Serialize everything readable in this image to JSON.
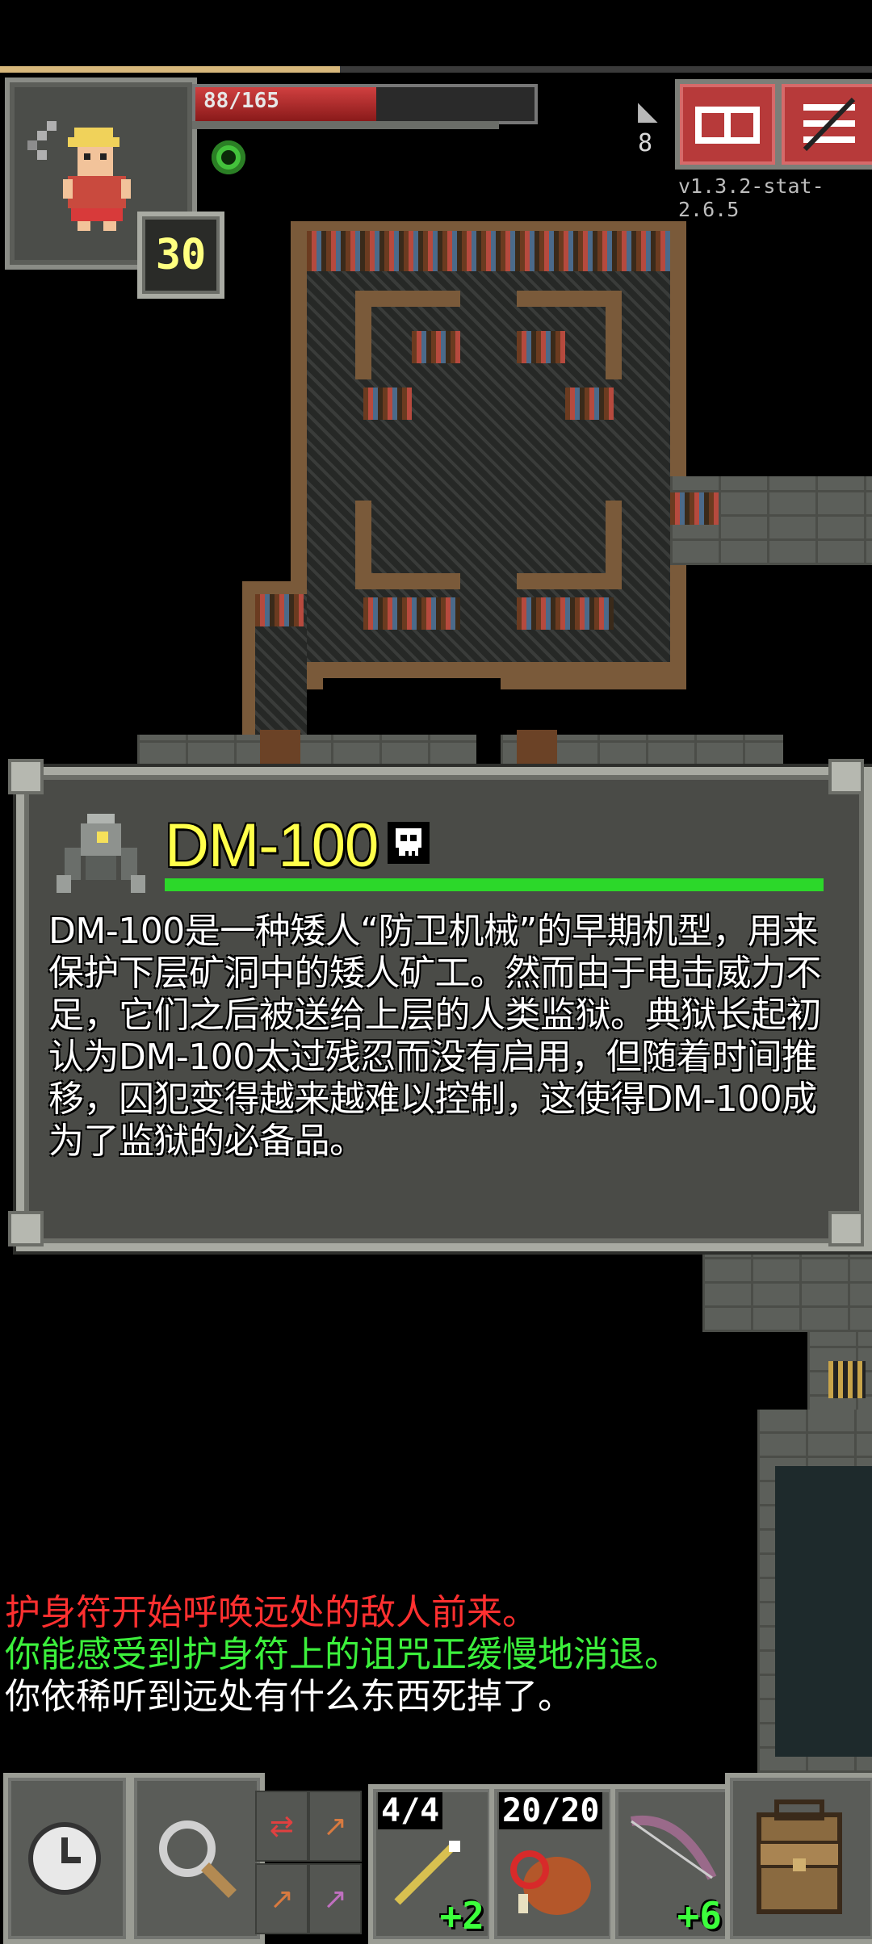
{
  "hero": {
    "level": "30",
    "hp_text": "88/165",
    "hp_current": 88,
    "hp_max": 165
  },
  "experience_fraction": 0.39,
  "depth": {
    "value": "8",
    "icon": "stairs-icon"
  },
  "version": "v1.3.2-stat-2.6.5",
  "buttons": {
    "journal_icon": "journal-icon",
    "menu_icon": "menu-icon"
  },
  "buff": {
    "icon": "green-skull-buff-icon",
    "color": "#43c23b"
  },
  "inspect": {
    "name": "DM-100",
    "hp_fraction": 1.0,
    "status_icon": "skull-icon",
    "description": "DM-100是一种矮人“防卫机械”的早期机型，用来保护下层矿洞中的矮人矿工。然而由于电击威力不足，它们之后被送给上层的人类监狱。典狱长起初认为DM-100太过残忍而没有启用，但随着时间推移，囚犯变得越来越难以控制，这使得DM-100成为了监狱的必备品。"
  },
  "log": [
    {
      "text": "护身符开始呼唤远处的敌人前来。",
      "color": "#ff3030"
    },
    {
      "text": "你能感受到护身符上的诅咒正缓慢地消退。",
      "color": "#3cf03c"
    },
    {
      "text": "你依稀听到远处有什么东西死掉了。",
      "color": "#ffffff"
    }
  ],
  "toolbar": {
    "wait_icon": "clock-icon",
    "search_icon": "magnifier-icon",
    "quickslots": [
      {
        "icon": "wand-icon",
        "qty": "4/4",
        "bonus": "+2"
      },
      {
        "icon": "meat-icon",
        "qty": "20/20",
        "bonus": ""
      },
      {
        "icon": "bow-icon",
        "qty": "",
        "bonus": "+6"
      }
    ],
    "backpack_icon": "backpack-icon"
  },
  "colors": {
    "hp_bar": "#c83434",
    "mob_name": "#ffff4a",
    "mob_hp": "#2cd82a",
    "window_bg": "#4a4b47"
  }
}
